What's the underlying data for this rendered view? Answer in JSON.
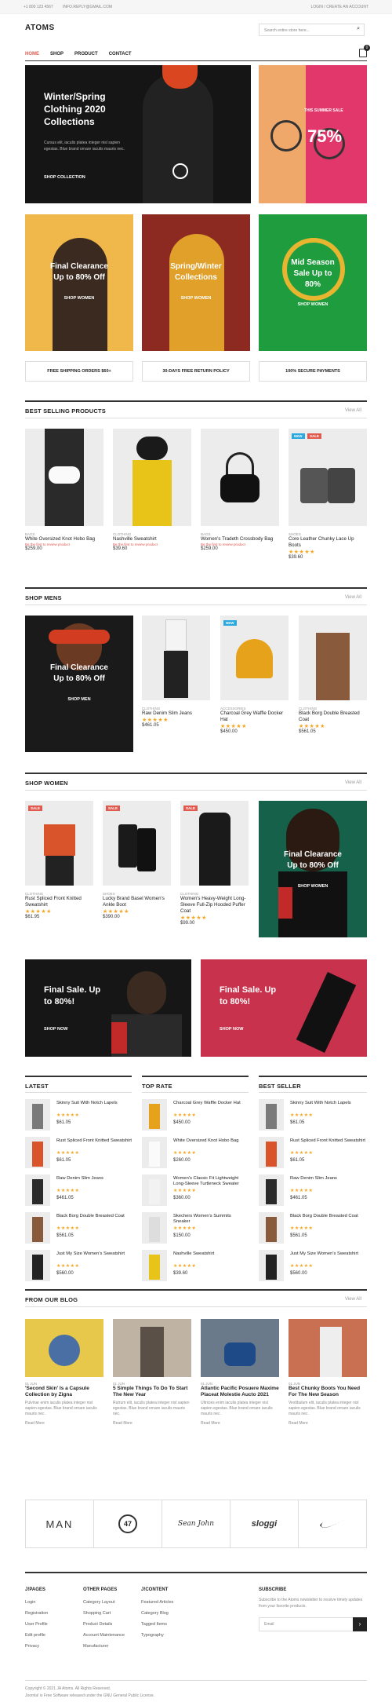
{
  "topbar": {
    "phone": "+1 800 123 4567",
    "email": "INFO.REPLY@GMAIL.COM",
    "account": "LOGIN / CREATE AN ACCOUNT"
  },
  "header": {
    "logo": "ATOMS",
    "search_placeholder": "Search entire store here...",
    "cart_count": "0"
  },
  "nav": [
    "HOME",
    "SHOP",
    "PRODUCT",
    "CONTACT"
  ],
  "hero": {
    "title1": "Winter/Spring",
    "title2": "Clothing 2020",
    "title3": "Collections",
    "body": "Cursus elit, iaculis platea integer nisl sapien egestas. Blue brand ornare iaculis mauris nec.",
    "cta": "SHOP COLLECTION",
    "side_label": "THIS SUMMER SALE",
    "side_pct": "75%"
  },
  "promos": [
    {
      "line1": "Final Clearance",
      "line2": "Up to 80% Off",
      "cta": "SHOP WOMEN"
    },
    {
      "line1": "Spring/Winter",
      "line2": "Collections",
      "cta": "SHOP WOMEN"
    },
    {
      "line1": "Mid Season",
      "line2": "Sale Up to",
      "line3": "80%",
      "cta": "SHOP WOMEN"
    }
  ],
  "features": [
    "FREE SHIPPING ORDERS $60+",
    "30-DAYS FREE RETURN POLICY",
    "100% SECURE PAYMENTS"
  ],
  "sections": {
    "best": "BEST SELLING PRODUCTS",
    "men": "SHOP MENS",
    "women": "SHOP WOMEN",
    "blog": "FROM OUR BLOG",
    "viewall": "View All"
  },
  "best": [
    {
      "cat": "BAGS",
      "name": "White Oversized Knot Hobo Bag",
      "sold": "Be the first to review product",
      "price": "$259.00"
    },
    {
      "cat": "CLOTHING",
      "name": "Nashville Sweatshirt",
      "sold": "Be the first to review product",
      "price": "$39.60"
    },
    {
      "cat": "BAGS",
      "name": "Women's Tradeth Crossbody Bag",
      "sold": "Be the first to review product",
      "price": "$259.00"
    },
    {
      "cat": "SHOES",
      "name": "Core Leather Chunky Lace Up Boots",
      "sold": "",
      "price": "$39.60",
      "badge1": "NEW",
      "badge2": "SALE"
    }
  ],
  "men_banner": {
    "line1": "Final Clearance",
    "line2": "Up to 80% Off",
    "cta": "SHOP MEN"
  },
  "men": [
    {
      "cat": "CLOTHING",
      "name": "Raw Denim Slim Jeans",
      "price": "$461.05"
    },
    {
      "cat": "ACCESSORIES",
      "name": "Charcoal Grey Waffle Docker Hat",
      "price": "$450.00",
      "badge": "NEW"
    },
    {
      "cat": "CLOTHING",
      "name": "Black Borg Double Breasted Coat",
      "price": "$561.05"
    }
  ],
  "women": [
    {
      "cat": "CLOTHING",
      "name": "Rust Spliced Front Knitted Sweatshirt",
      "price": "$61.95",
      "badge": "SALE"
    },
    {
      "cat": "SHOES",
      "name": "Lucky Brand Basel Women's Ankle Boot",
      "price": "$390.00",
      "badge": "SALE"
    },
    {
      "cat": "CLOTHING",
      "name": "Women's Heavy-Weight Long-Sleeve Full-Zip Hooded Puffer Coat",
      "price": "$99.00",
      "badge": "SALE"
    }
  ],
  "women_banner": {
    "line1": "Final Clearance",
    "line2": "Up to 80% Off",
    "cta": "SHOP WOMEN"
  },
  "sale_banners": [
    {
      "line1": "Final Sale. Up",
      "line2": "to 80%!",
      "cta": "SHOP NOW"
    },
    {
      "line1": "Final Sale. Up",
      "line2": "to 80%!",
      "cta": "SHOP NOW"
    }
  ],
  "lists": {
    "latest": {
      "title": "LATEST",
      "items": [
        {
          "name": "Skinny Suit With Notch Lapels",
          "price": "$61.05"
        },
        {
          "name": "Rust Spliced Front Knitted Sweatshirt",
          "price": "$61.05"
        },
        {
          "name": "Raw Denim Slim Jeans",
          "price": "$461.05"
        },
        {
          "name": "Black Borg Double Breasted Coat",
          "price": "$561.05"
        },
        {
          "name": "Just My Size Women's Sweatshirt",
          "price": "$560.00"
        }
      ]
    },
    "top": {
      "title": "TOP RATE",
      "items": [
        {
          "name": "Charcoal Grey Waffle Docker Hat",
          "price": "$450.00"
        },
        {
          "name": "White Oversized Knot Hobo Bag",
          "price": "$260.00"
        },
        {
          "name": "Women's Classic Fit Lightweight Long-Sleeve Turtleneck Sweater",
          "price": "$360.00"
        },
        {
          "name": "Skechers Women's Summits Sneaker",
          "price": "$150.00"
        },
        {
          "name": "Nashville Sweatshirt",
          "price": "$39.60"
        }
      ]
    },
    "seller": {
      "title": "BEST SELLER",
      "items": [
        {
          "name": "Skinny Suit With Notch Lapels",
          "price": "$61.05"
        },
        {
          "name": "Rust Spliced Front Knitted Sweatshirt",
          "price": "$61.05"
        },
        {
          "name": "Raw Denim Slim Jeans",
          "price": "$461.05"
        },
        {
          "name": "Black Borg Double Breasted Coat",
          "price": "$561.05"
        },
        {
          "name": "Just My Size Women's Sweatshirt",
          "price": "$560.00"
        }
      ]
    }
  },
  "blog": [
    {
      "date": "01 JUN",
      "title": "'Second Skin' Is a Capsule Collection by Zigna",
      "body": "Pulvinar enim iaculis platea integer nisl sapien egestas. Blue brand ornare iaculis mauris nec.",
      "more": "Read More"
    },
    {
      "date": "01 JUN",
      "title": "5 Simple Things To Do To Start The New Year",
      "body": "Rutrum elit, iaculis platea integer nisl sapien egestas. Blue brand ornare iaculis mauris nec.",
      "more": "Read More"
    },
    {
      "date": "01 JUN",
      "title": "Atlantic Pacific Posuere Maxime Placeat Molestie Aucto 2021",
      "body": "Ultricies enim iaculis platea integer nisl sapien egestas. Blue brand ornare iaculis mauris nec.",
      "more": "Read More"
    },
    {
      "date": "01 JUN",
      "title": "Best Chunky Boots You Need For The New Season",
      "body": "Vestibulum elit, iaculis platea integer nisl sapien egestas. Blue brand ornare iaculis mauris nec.",
      "more": "Read More"
    }
  ],
  "brands": [
    "MAN",
    "47",
    "Sean John",
    "sloggi",
    "nike"
  ],
  "footer": {
    "cols": [
      {
        "title": "J!PAGES",
        "links": [
          "Login",
          "Registration",
          "User Profile",
          "Edit profile",
          "Privacy"
        ]
      },
      {
        "title": "OTHER PAGES",
        "links": [
          "Category Layout",
          "Shopping Cart",
          "Product Details",
          "Account Maintenance",
          "Manufacturer"
        ]
      },
      {
        "title": "J!CONTENT",
        "links": [
          "Featured Articles",
          "Category Blog",
          "Tagged Items",
          "Typography"
        ]
      }
    ],
    "sub_title": "SUBSCRIBE",
    "sub_text": "Subscribe to the Atoms newsletter to receive timely updates from your favorite products.",
    "email_placeholder": "Email",
    "copy1": "Copyright © 2021 JA Atoms. All Rights Reserved.",
    "copy2": "Joomla! is Free Software released under the GNU General Public License."
  }
}
